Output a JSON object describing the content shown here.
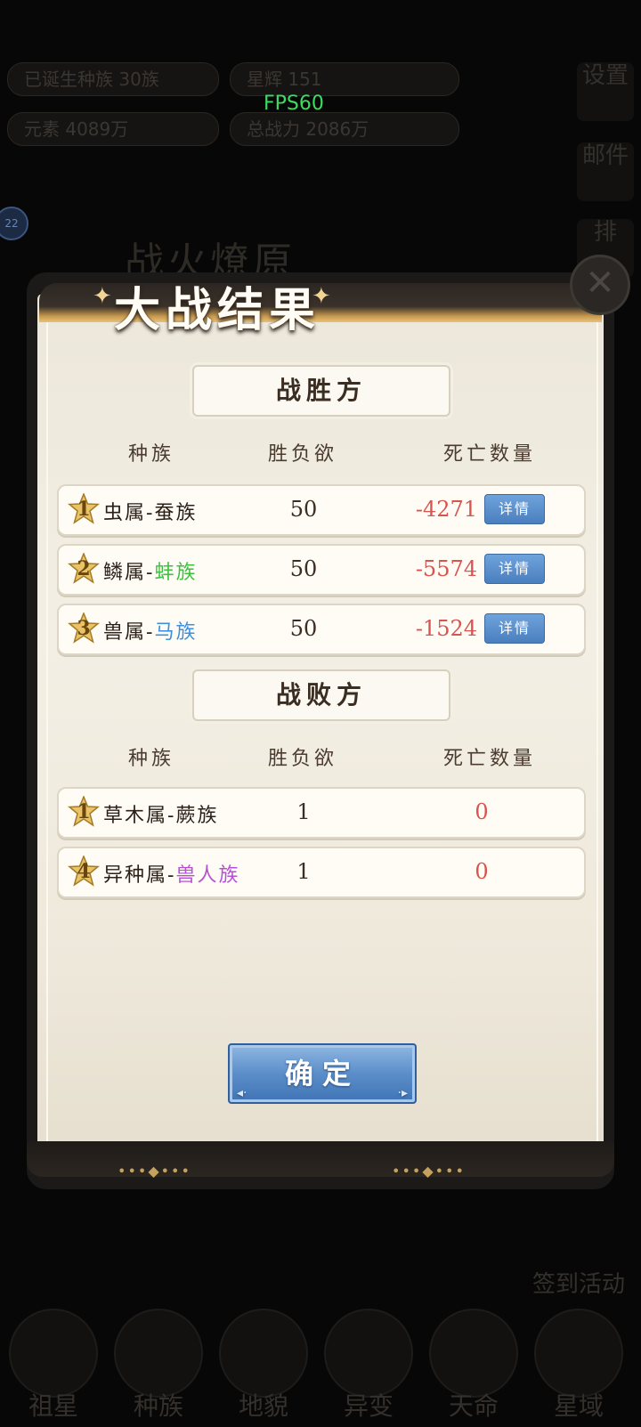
{
  "status_overlay": {
    "fps": "FPS60"
  },
  "background_hud": {
    "top_pills": [
      "已诞生种族 30族",
      "星辉 151",
      "元素 4089万",
      "总战力 2086万"
    ],
    "side_buttons": [
      "设置",
      "邮件",
      "排"
    ],
    "badge": "22",
    "sign_label": "签到活动",
    "bg_title": "战火燎原",
    "nav_items": [
      "祖星",
      "种族",
      "地貌",
      "异变",
      "天命",
      "星域"
    ]
  },
  "dialog": {
    "title": "大战结果",
    "close_icon": "close-icon",
    "winner": {
      "header": "战胜方",
      "columns": [
        "种族",
        "胜负欲",
        "死亡数量"
      ],
      "rows": [
        {
          "rank": "1",
          "genus": "虫属-",
          "race": "蚕族",
          "race_color": "#2b2018",
          "desire": "50",
          "deaths": "-4271",
          "detail": "详情"
        },
        {
          "rank": "2",
          "genus": "鳞属-",
          "race": "蚌族",
          "race_color": "#3fbf3f",
          "desire": "50",
          "deaths": "-5574",
          "detail": "详情"
        },
        {
          "rank": "3",
          "genus": "兽属-",
          "race": "马族",
          "race_color": "#3d8fe0",
          "desire": "50",
          "deaths": "-1524",
          "detail": "详情"
        }
      ]
    },
    "loser": {
      "header": "战败方",
      "columns": [
        "种族",
        "胜负欲",
        "死亡数量"
      ],
      "rows": [
        {
          "rank": "1",
          "genus": "草木属-",
          "race": "蕨族",
          "race_color": "#2b2018",
          "desire": "1",
          "deaths": "0"
        },
        {
          "rank": "4",
          "genus": "异种属-",
          "race": "兽人族",
          "race_color": "#b64fd6",
          "desire": "1",
          "deaths": "0"
        }
      ]
    },
    "confirm_label": "确定"
  },
  "colors": {
    "loss": "#d9534f",
    "panel": "#f3efe4",
    "button_blue": "#4a7fbf"
  }
}
